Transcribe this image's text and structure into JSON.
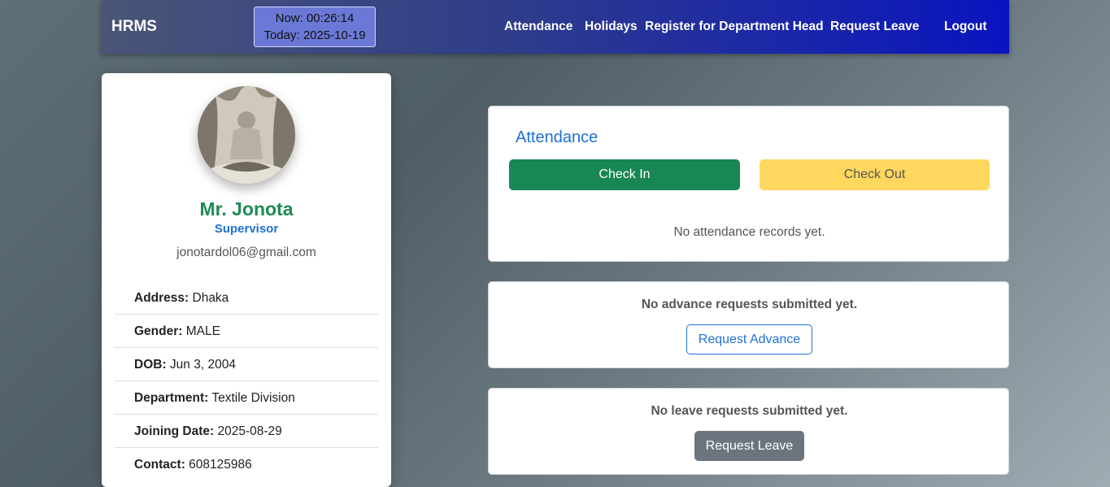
{
  "nav": {
    "brand": "HRMS",
    "clock_now": "Now: 00:26:14",
    "clock_today": "Today: 2025-10-19",
    "links": [
      "Attendance",
      "Holidays",
      "Register for Department Head",
      "Request Leave"
    ],
    "logout": "Logout"
  },
  "profile": {
    "avatar_icon": "profile-photo",
    "name": "Mr. Jonota",
    "role": "Supervisor",
    "email": "jonotardol06@gmail.com",
    "details": [
      {
        "label": "Address:",
        "value": "Dhaka"
      },
      {
        "label": "Gender:",
        "value": "MALE"
      },
      {
        "label": "DOB:",
        "value": "Jun 3, 2004"
      },
      {
        "label": "Department:",
        "value": "Textile Division"
      },
      {
        "label": "Joining Date:",
        "value": "2025-08-29"
      },
      {
        "label": "Contact:",
        "value": "608125986"
      }
    ]
  },
  "attendance": {
    "title": "Attendance",
    "check_in": "Check In",
    "check_out": "Check Out",
    "empty": "No attendance records yet."
  },
  "advance": {
    "empty": "No advance requests submitted yet.",
    "button": "Request Advance"
  },
  "leave": {
    "empty": "No leave requests submitted yet.",
    "button": "Request Leave"
  },
  "colors": {
    "primary": "#1d6fd8",
    "success": "#198754",
    "warning": "#ffd75e",
    "secondary": "#6c757d",
    "nav_end": "#0a14c0"
  }
}
